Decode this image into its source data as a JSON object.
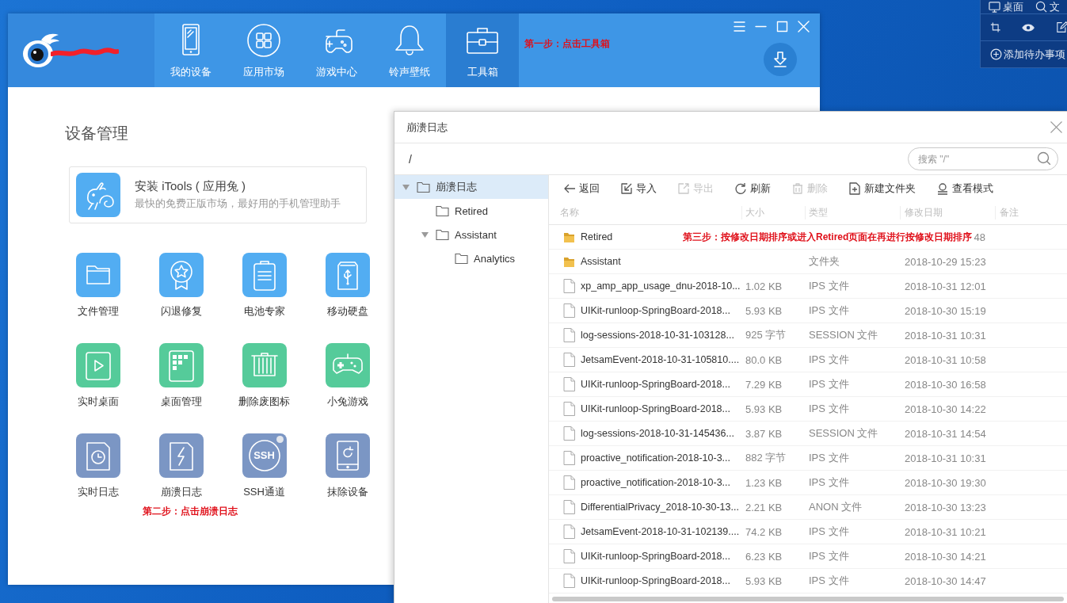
{
  "main_window": {
    "nav": [
      {
        "label": "我的设备",
        "kind": "device",
        "selected": false
      },
      {
        "label": "应用市场",
        "kind": "apps",
        "selected": false
      },
      {
        "label": "游戏中心",
        "kind": "games",
        "selected": false
      },
      {
        "label": "铃声壁纸",
        "kind": "ringtone",
        "selected": false
      },
      {
        "label": "工具箱",
        "kind": "toolbox",
        "selected": true
      }
    ],
    "annotation": "第一步：点击工具箱",
    "section_title": "设备管理",
    "install_card": {
      "title": "安装 iTools ( 应用兔 )",
      "subtitle": "最快的免费正版市场，最好用的手机管理助手"
    },
    "tools": [
      {
        "label": "文件管理",
        "kind": "folder",
        "color": "#52adf2",
        "dot": false
      },
      {
        "label": "闪退修复",
        "kind": "medal",
        "color": "#52adf2",
        "dot": false
      },
      {
        "label": "电池专家",
        "kind": "clipboard",
        "color": "#52adf2",
        "dot": false
      },
      {
        "label": "移动硬盘",
        "kind": "usb",
        "color": "#52adf2",
        "dot": false
      },
      {
        "label": "实时桌面",
        "kind": "play",
        "color": "#55cb9a",
        "dot": false
      },
      {
        "label": "桌面管理",
        "kind": "grid",
        "color": "#55cb9a",
        "dot": false
      },
      {
        "label": "删除废图标",
        "kind": "trash",
        "color": "#55cb9a",
        "dot": false
      },
      {
        "label": "小兔游戏",
        "kind": "gamepad",
        "color": "#55cb9a",
        "dot": false
      },
      {
        "label": "实时日志",
        "kind": "clock",
        "color": "#7b96c4",
        "dot": false
      },
      {
        "label": "崩溃日志",
        "kind": "bolt",
        "color": "#7b96c4",
        "dot": false
      },
      {
        "label": "SSH通道",
        "kind": "ssh",
        "icon_text": "SSH",
        "color": "#7b96c4",
        "dot": true
      },
      {
        "label": "抹除设备",
        "kind": "wipe",
        "color": "#7b96c4",
        "dot": false
      }
    ],
    "tools_annotation": "第二步：点击崩溃日志"
  },
  "dialog": {
    "title": "崩溃日志",
    "path": "/",
    "search": {
      "placeholder": "搜索 \"/\""
    },
    "tree": [
      {
        "label": "崩溃日志",
        "selected": true,
        "expanded": true,
        "children": [
          {
            "label": "Retired",
            "selected": false
          },
          {
            "label": "Assistant",
            "selected": false,
            "expanded": true,
            "children": [
              {
                "label": "Analytics",
                "selected": false
              }
            ]
          }
        ]
      }
    ],
    "toolbar": [
      {
        "label": "返回",
        "kind": "back",
        "disabled": false
      },
      {
        "label": "导入",
        "kind": "import",
        "disabled": false
      },
      {
        "label": "导出",
        "kind": "export",
        "disabled": true
      },
      {
        "label": "刷新",
        "kind": "refresh",
        "disabled": false
      },
      {
        "label": "删除",
        "kind": "delete",
        "disabled": true
      },
      {
        "label": "新建文件夹",
        "kind": "new_folder",
        "disabled": false
      },
      {
        "label": "查看模式",
        "kind": "view",
        "disabled": false
      }
    ],
    "columns": [
      "名称",
      "大小",
      "类型",
      "修改日期",
      "备注"
    ],
    "rows": [
      {
        "kind": "folder",
        "name": "Retired",
        "annotation": "第三步：按修改日期排序或进入Retired页面在再进行按修改日期排序",
        "date": "48"
      },
      {
        "kind": "folder",
        "name": "Assistant",
        "type": "文件夹",
        "date": "2018-10-29 15:23"
      },
      {
        "kind": "file",
        "name": "xp_amp_app_usage_dnu-2018-10...",
        "size": "1.02 KB",
        "type": "IPS 文件",
        "date": "2018-10-31 12:01"
      },
      {
        "kind": "file",
        "name": "UIKit-runloop-SpringBoard-2018...",
        "size": "5.93 KB",
        "type": "IPS 文件",
        "date": "2018-10-30 15:19"
      },
      {
        "kind": "file",
        "name": "log-sessions-2018-10-31-103128...",
        "size": "925 字节",
        "type": "SESSION 文件",
        "date": "2018-10-31 10:31"
      },
      {
        "kind": "file",
        "name": "JetsamEvent-2018-10-31-105810....",
        "size": "80.0 KB",
        "type": "IPS 文件",
        "date": "2018-10-31 10:58"
      },
      {
        "kind": "file",
        "name": "UIKit-runloop-SpringBoard-2018...",
        "size": "7.29 KB",
        "type": "IPS 文件",
        "date": "2018-10-30 16:58"
      },
      {
        "kind": "file",
        "name": "UIKit-runloop-SpringBoard-2018...",
        "size": "5.93 KB",
        "type": "IPS 文件",
        "date": "2018-10-30 14:22"
      },
      {
        "kind": "file",
        "name": "log-sessions-2018-10-31-145436...",
        "size": "3.87 KB",
        "type": "SESSION 文件",
        "date": "2018-10-31 14:54"
      },
      {
        "kind": "file",
        "name": "proactive_notification-2018-10-3...",
        "size": "882 字节",
        "type": "IPS 文件",
        "date": "2018-10-31 10:31"
      },
      {
        "kind": "file",
        "name": "proactive_notification-2018-10-3...",
        "size": "1.23 KB",
        "type": "IPS 文件",
        "date": "2018-10-30 19:30"
      },
      {
        "kind": "file",
        "name": "DifferentialPrivacy_2018-10-30-13...",
        "size": "2.21 KB",
        "type": "ANON 文件",
        "date": "2018-10-30 13:23"
      },
      {
        "kind": "file",
        "name": "JetsamEvent-2018-10-31-102139....",
        "size": "74.2 KB",
        "type": "IPS 文件",
        "date": "2018-10-31 10:21"
      },
      {
        "kind": "file",
        "name": "UIKit-runloop-SpringBoard-2018...",
        "size": "6.23 KB",
        "type": "IPS 文件",
        "date": "2018-10-30 14:21"
      },
      {
        "kind": "file",
        "name": "UIKit-runloop-SpringBoard-2018...",
        "size": "5.93 KB",
        "type": "IPS 文件",
        "date": "2018-10-30 14:47"
      }
    ]
  },
  "desktop_widget": {
    "buttons": [
      {
        "kind": "monitor",
        "label": "桌面"
      },
      {
        "kind": "search",
        "label": "文"
      }
    ],
    "todo": "添加待办事项"
  }
}
